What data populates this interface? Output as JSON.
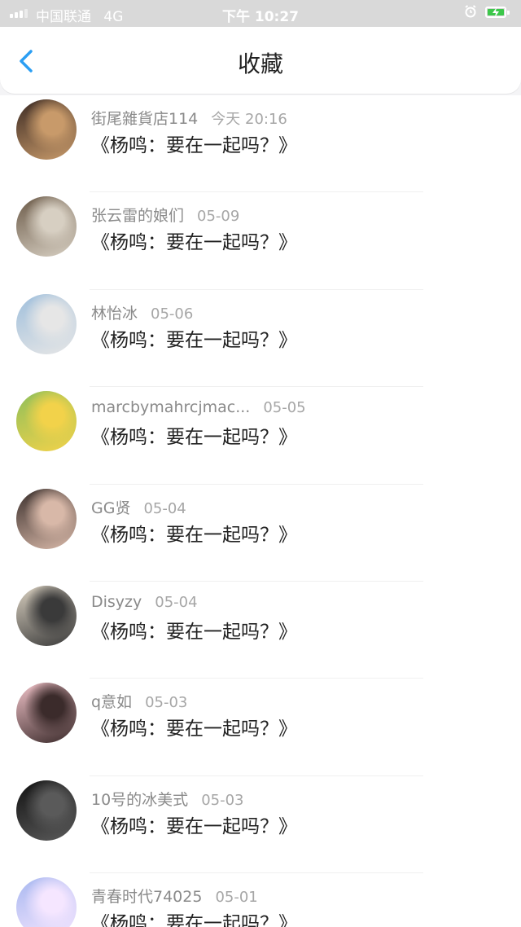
{
  "status_bar": {
    "carrier": "中国联通",
    "network": "4G",
    "time": "下午 10:27"
  },
  "header": {
    "title": "收藏"
  },
  "colors": {
    "accent": "#2b9ef3",
    "battery": "#3cc74a"
  },
  "items": [
    {
      "user": "街尾雜貨店114",
      "date": "今天 20:16",
      "title": "《杨鸣：要在一起吗？》",
      "avatar_colors": [
        "#3b2a23",
        "#c89a6a"
      ]
    },
    {
      "user": "张云雷的娘们",
      "date": "05-09",
      "title": "《杨鸣：要在一起吗？》",
      "avatar_colors": [
        "#6b5a48",
        "#d7cfc2"
      ]
    },
    {
      "user": "林怡冰",
      "date": "05-06",
      "title": "《杨鸣：要在一起吗？》",
      "avatar_colors": [
        "#9fbfdc",
        "#e6e6e6"
      ]
    },
    {
      "user": "marcbymahrcjmac...",
      "date": "05-05",
      "title": "《杨鸣：要在一起吗？》",
      "avatar_colors": [
        "#8fbf5a",
        "#f2d24a"
      ]
    },
    {
      "user": "GG贤",
      "date": "05-04",
      "title": "《杨鸣：要在一起吗？》",
      "avatar_colors": [
        "#3a2f2c",
        "#d8b8a8"
      ]
    },
    {
      "user": "Disyzy",
      "date": "05-04",
      "title": "《杨鸣：要在一起吗？》",
      "avatar_colors": [
        "#d8cfbf",
        "#3a3a3a"
      ]
    },
    {
      "user": "q意如",
      "date": "05-03",
      "title": "《杨鸣：要在一起吗？》",
      "avatar_colors": [
        "#f0c2c8",
        "#3b2b2b"
      ]
    },
    {
      "user": "10号的冰美式",
      "date": "05-03",
      "title": "《杨鸣：要在一起吗？》",
      "avatar_colors": [
        "#111111",
        "#5a5a5a"
      ]
    },
    {
      "user": "青春时代74025",
      "date": "05-01",
      "title": "《杨鸣：要在一起吗？》",
      "avatar_colors": [
        "#a8b8f0",
        "#f5e6ff"
      ]
    }
  ]
}
